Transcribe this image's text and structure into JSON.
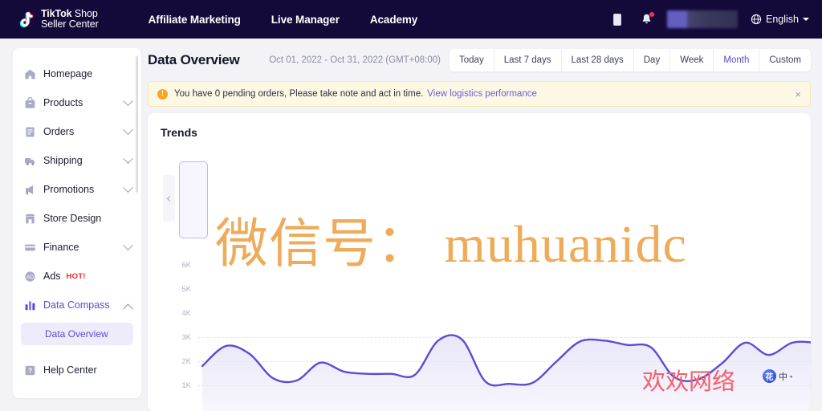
{
  "header": {
    "logo": {
      "icon": "tiktok-note-icon",
      "line1_bold": "TikTok",
      "line1_rest": " Shop",
      "line2": "Seller Center"
    },
    "nav": [
      {
        "label": "Affiliate Marketing"
      },
      {
        "label": "Live Manager"
      },
      {
        "label": "Academy"
      }
    ],
    "mobile_icon": "mobile-device-icon",
    "bell_icon": "notification-bell-icon",
    "bell_has_dot": true,
    "account_redacted": true,
    "language": {
      "icon": "globe-icon",
      "label": "English",
      "caret": "chevron-down-icon"
    }
  },
  "sidebar": {
    "items": [
      {
        "label": "Homepage",
        "icon": "home-icon",
        "expandable": false,
        "active": false
      },
      {
        "label": "Products",
        "icon": "bag-icon",
        "expandable": true,
        "active": false
      },
      {
        "label": "Orders",
        "icon": "clipboard-icon",
        "expandable": true,
        "active": false
      },
      {
        "label": "Shipping",
        "icon": "truck-icon",
        "expandable": true,
        "active": false
      },
      {
        "label": "Promotions",
        "icon": "megaphone-icon",
        "expandable": true,
        "active": false
      },
      {
        "label": "Store Design",
        "icon": "storefront-icon",
        "expandable": false,
        "active": false
      },
      {
        "label": "Finance",
        "icon": "card-icon",
        "expandable": true,
        "active": false
      },
      {
        "label": "Ads",
        "icon": "ads-icon",
        "expandable": false,
        "active": false,
        "badge": "HOT!"
      },
      {
        "label": "Data Compass",
        "icon": "bar-chart-icon",
        "expandable": true,
        "active": true,
        "expanded": true
      },
      {
        "label": "Help Center",
        "icon": "help-icon",
        "expandable": false,
        "active": false
      }
    ],
    "sub_item": {
      "label": "Data Overview",
      "selected": true
    },
    "badge_color": "#f5222d",
    "active_color": "#5a4bd4"
  },
  "page": {
    "title": "Data Overview",
    "date_range": "Oct 01, 2022 - Oct 31, 2022 (GMT+08:00)",
    "range_buttons": [
      {
        "label": "Today",
        "selected": false
      },
      {
        "label": "Last 7 days",
        "selected": false
      },
      {
        "label": "Last 28 days",
        "selected": false
      },
      {
        "label": "Day",
        "selected": false
      },
      {
        "label": "Week",
        "selected": false
      },
      {
        "label": "Month",
        "selected": true
      },
      {
        "label": "Custom",
        "selected": false
      }
    ]
  },
  "banner": {
    "icon": "warning-icon",
    "text": "You have 0 pending orders, Please take note and act in time.",
    "link": "View logistics performance",
    "close": "×",
    "bg_color": "#fdf8e4",
    "border_color": "#f5e7b8",
    "icon_color": "#f5a623"
  },
  "panel": {
    "title": "Trends",
    "prev_button": "chevron-left-icon",
    "metric_card_selected": true
  },
  "chart_data": {
    "type": "area",
    "title": "Trends",
    "xlabel": "",
    "ylabel": "",
    "grid": true,
    "legend": null,
    "line_color": "#5b4bd6",
    "fill_color": "#e8e6f9",
    "ytick_labels": [
      "6K",
      "5K",
      "4K",
      "3K",
      "2K",
      "1K"
    ],
    "ytick_values": [
      6000,
      5000,
      4000,
      3000,
      2000,
      1000
    ],
    "ylim": [
      0,
      6500
    ],
    "series": [
      {
        "name": "Trend",
        "values": [
          1950,
          2850,
          2500,
          1400,
          1300,
          2100,
          1700,
          1600,
          1600,
          1550,
          3100,
          3150,
          1250,
          1150,
          1200,
          2150,
          3050,
          3100,
          2900,
          2800,
          1450,
          1350,
          2050,
          3000,
          2450,
          3000,
          3000,
          2900,
          2950,
          3000,
          3000
        ]
      }
    ]
  },
  "watermarks": {
    "orange_text": "微信号： muhuanidc",
    "orange_color": "#eda54d",
    "red_text": "欢欢网络",
    "red_color": "#f4606c",
    "ime": {
      "ball": "花",
      "mode": "中",
      "dot": "▪"
    }
  }
}
